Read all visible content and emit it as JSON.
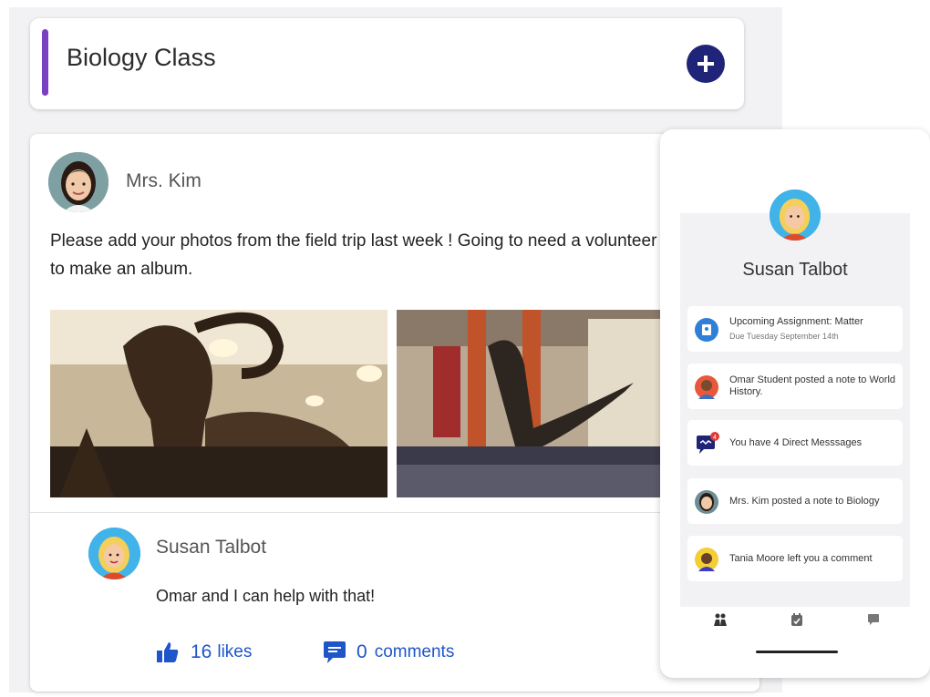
{
  "header": {
    "title": "Biology Class",
    "add_icon": "plus-icon"
  },
  "post": {
    "author": "Mrs. Kim",
    "text": "Please add your photos from the field trip last week ! Going to need a volunteer to make an album.",
    "photos": [
      "mammoth-skeleton-photo",
      "dinosaur-skeleton-hall-photo"
    ]
  },
  "comment": {
    "author": "Susan Talbot",
    "text": "Omar and I can help with that!",
    "likes_count": "16",
    "likes_label": "likes",
    "comments_count": "0",
    "comments_label": "comments"
  },
  "phone": {
    "profile_name": "Susan Talbot",
    "notifications": [
      {
        "text": "Upcoming Assignment: Matter",
        "sub": "Due Tuesday September 14th",
        "icon": "assignment-icon"
      },
      {
        "text": "Omar Student posted a note to World History.",
        "icon": "avatar-omar"
      },
      {
        "text": "You have 4 Direct Messsages",
        "badge": "4",
        "icon": "message-icon"
      },
      {
        "text": "Mrs. Kim posted a note to Biology",
        "icon": "avatar-kim"
      },
      {
        "text": "Tania Moore left you a comment",
        "icon": "avatar-tania"
      }
    ],
    "nav": [
      "classes-icon",
      "assignments-icon",
      "messages-icon"
    ]
  },
  "colors": {
    "accent": "#7b3fc4",
    "button": "#1f2478",
    "link": "#1e55c9"
  }
}
